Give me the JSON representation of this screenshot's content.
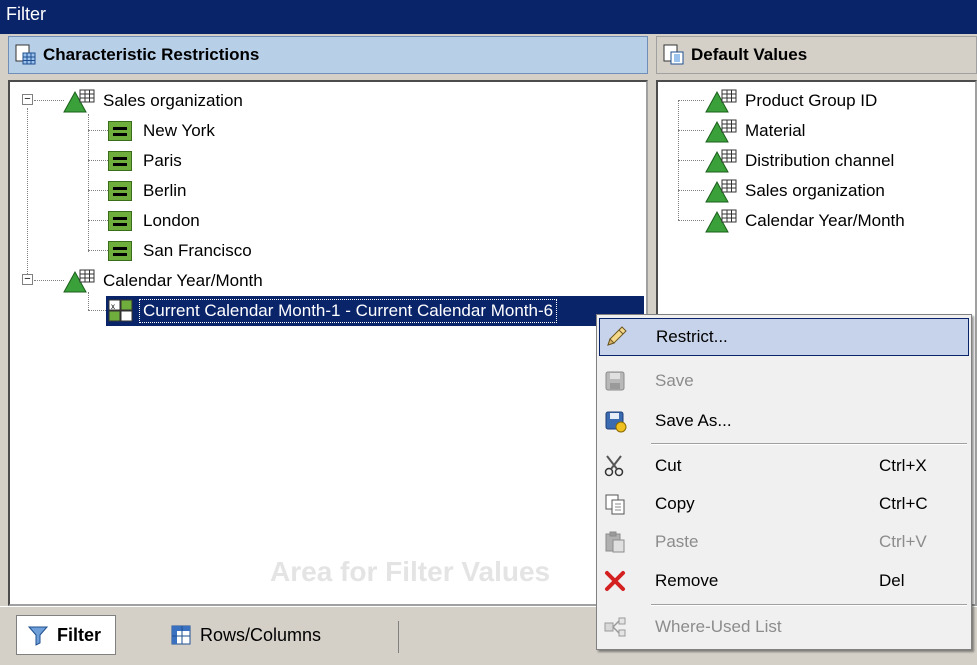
{
  "window": {
    "title": "Filter"
  },
  "left_pane": {
    "title": "Characteristic Restrictions",
    "tree": [
      {
        "label": "Sales organization",
        "children": [
          "New York",
          "Paris",
          "Berlin",
          "London",
          "San Francisco"
        ]
      },
      {
        "label": "Calendar Year/Month",
        "children": [
          "Current Calendar Month-1 - Current Calendar Month-6"
        ]
      }
    ],
    "watermark": "Area for Filter Values"
  },
  "right_pane": {
    "title": "Default Values",
    "items": [
      "Product Group ID",
      "Material",
      "Distribution channel",
      "Sales organization",
      "Calendar Year/Month"
    ]
  },
  "tabs": [
    {
      "label": "Filter",
      "active": true
    },
    {
      "label": "Rows/Columns",
      "active": false
    }
  ],
  "context_menu": {
    "items": [
      {
        "label": "Restrict...",
        "shortcut": "",
        "enabled": true,
        "icon": "pencil-icon"
      },
      {
        "label": "Save",
        "shortcut": "",
        "enabled": false,
        "icon": "save-icon"
      },
      {
        "label": "Save As...",
        "shortcut": "",
        "enabled": true,
        "icon": "save-as-icon"
      },
      {
        "label": "Cut",
        "shortcut": "Ctrl+X",
        "enabled": true,
        "icon": "scissors-icon"
      },
      {
        "label": "Copy",
        "shortcut": "Ctrl+C",
        "enabled": true,
        "icon": "copy-icon"
      },
      {
        "label": "Paste",
        "shortcut": "Ctrl+V",
        "enabled": false,
        "icon": "paste-icon"
      },
      {
        "label": "Remove",
        "shortcut": "Del",
        "enabled": true,
        "icon": "remove-x-icon"
      },
      {
        "label": "Where-Used List",
        "shortcut": "",
        "enabled": false,
        "icon": "where-used-icon"
      }
    ]
  },
  "colors": {
    "title_bar": "#0a246a",
    "selection": "#0a246a",
    "header_blue": "#b8cfe8",
    "menu_hover": "#c6d3ea",
    "restriction_green": "#6fae3c"
  }
}
